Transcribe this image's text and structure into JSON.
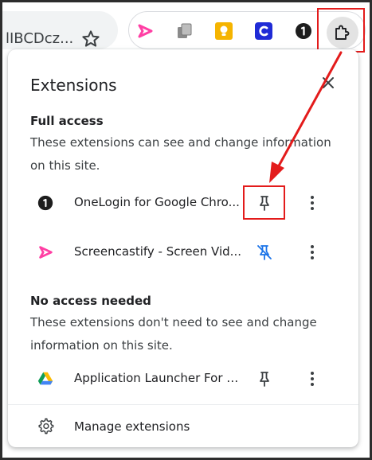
{
  "toolbar": {
    "omnibox_text": "lIBCDcz...",
    "toolbar_extensions": [
      "screencastify-icon",
      "copy-extension-icon",
      "yellow-extension-icon",
      "c-extension-icon",
      "onelogin-icon",
      "extensions-puzzle-icon"
    ]
  },
  "popup": {
    "title": "Extensions",
    "full_access": {
      "title": "Full access",
      "description": "These extensions can see and change information on this site.",
      "items": [
        {
          "name": "OneLogin for Google Chro...",
          "pinned": true
        },
        {
          "name": "Screencastify - Screen Vid...",
          "pinned": false
        }
      ]
    },
    "no_access": {
      "title": "No access needed",
      "description": "These extensions don't need to see and change information on this site.",
      "items": [
        {
          "name": "Application Launcher For D...",
          "pinned": true
        }
      ]
    },
    "manage_label": "Manage extensions"
  },
  "colors": {
    "highlight": "#e31b1b",
    "pin_blue": "#1a73e8",
    "screencastify_pink": "#ff3fa4",
    "onelogin_black": "#1d1d1d"
  }
}
